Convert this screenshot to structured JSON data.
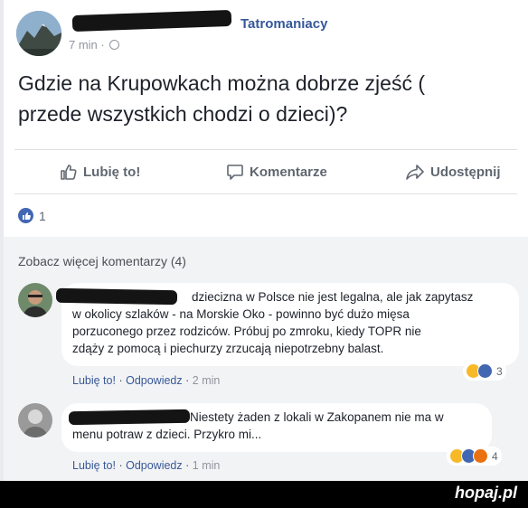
{
  "post": {
    "group_name": "Tatromaniacy",
    "time": "7 min",
    "text_lines": [
      "Gdzie na Krupowkach można dobrze zjeść (",
      "przede wszystkich chodzi o dzieci)?"
    ]
  },
  "actions": {
    "like": "Lubię to!",
    "comment": "Komentarze",
    "share": "Udostępnij"
  },
  "reactions": {
    "count": "1",
    "icon": "like-icon"
  },
  "comments_section": {
    "see_more": "Zobacz więcej komentarzy (4)",
    "comments": [
      {
        "lines": [
          "dziecizna w Polsce nie jest legalna, ale jak zapytasz",
          "w okolicy szlaków - na Morskie Oko - powinno być dużo mięsa",
          "porzuconego przez rodziców. Próbuj po zmroku, kiedy TOPR nie",
          "zdąży z pomocą i piechurzy zrzucają niepotrzebny balast."
        ],
        "like_label": "Lubię to!",
        "reply_label": "Odpowiedz",
        "time": "2 min",
        "reaction_count": "3",
        "reaction_icons": [
          "haha-icon",
          "like-icon"
        ]
      },
      {
        "lines": [
          "Niestety żaden z lokali w Zakopanem nie ma w",
          "menu potraw z dzieci. Przykro mi..."
        ],
        "like_label": "Lubię to!",
        "reply_label": "Odpowiedz",
        "time": "1 min",
        "reaction_count": "4",
        "reaction_icons": [
          "haha-icon",
          "like-icon",
          "angry-icon"
        ]
      }
    ]
  },
  "watermark": "hopaj.pl",
  "colors": {
    "accent": "#4267b2",
    "link": "#365899",
    "muted": "#90949c",
    "comments_bg": "#f2f3f5"
  }
}
